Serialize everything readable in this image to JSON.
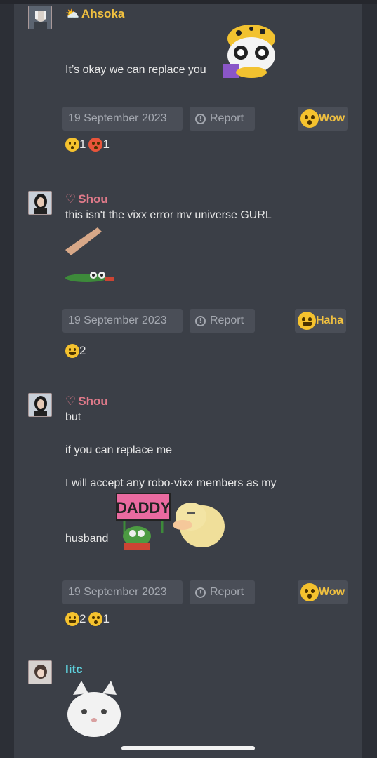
{
  "messages": [
    {
      "author": "Ahsoka",
      "author_color": "#f0c040",
      "lines": [
        "It’s okay we can replace you"
      ],
      "date": "19 September 2023",
      "report": "Report",
      "my_reaction": "Wow",
      "counts": [
        "1",
        "1"
      ]
    },
    {
      "author": "Shou",
      "author_color": "#e07a8a",
      "lines": [
        "this isn't the vixx error mv universe GURL"
      ],
      "date": "19 September 2023",
      "report": "Report",
      "my_reaction": "Haha",
      "counts": [
        "2"
      ]
    },
    {
      "author": "Shou",
      "author_color": "#e07a8a",
      "lines": [
        "but",
        "if you can replace me",
        "I will accept any robo-vixx members as my",
        "husband"
      ],
      "sticker_text": "DADDY",
      "date": "19 September 2023",
      "report": "Report",
      "my_reaction": "Wow",
      "counts": [
        "2",
        "1"
      ]
    },
    {
      "author": "litc",
      "author_color": "#5fd4e0"
    }
  ]
}
